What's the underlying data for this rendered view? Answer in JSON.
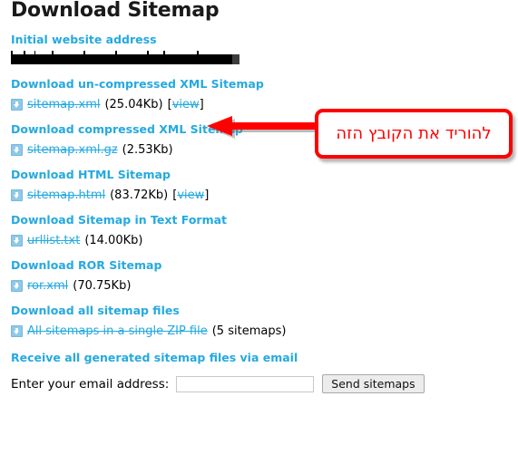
{
  "page": {
    "title": "Download Sitemap"
  },
  "initial": {
    "heading": "Initial website address",
    "url_redacted": true
  },
  "sections": [
    {
      "heading": "Download un-compressed XML Sitemap",
      "icon": "download-icon",
      "file_name": "sitemap.xml",
      "file_size": "(25.04Kb)",
      "view_open": "[",
      "view_label": "view",
      "view_close": "]"
    },
    {
      "heading": "Download compressed XML Sitemap",
      "icon": "download-icon",
      "file_name": "sitemap.xml.gz",
      "file_size": "(2.53Kb)"
    },
    {
      "heading": "Download HTML Sitemap",
      "icon": "download-icon",
      "file_name": "sitemap.html",
      "file_size": "(83.72Kb)",
      "view_open": "[",
      "view_label": "view",
      "view_close": "]"
    },
    {
      "heading": "Download Sitemap in Text Format",
      "icon": "download-icon",
      "file_name": "urllist.txt",
      "file_size": "(14.00Kb)"
    },
    {
      "heading": "Download ROR Sitemap",
      "icon": "download-icon",
      "file_name": "ror.xml",
      "file_size": "(70.75Kb)"
    },
    {
      "heading": "Download all sitemap files",
      "icon": "download-icon",
      "file_name": "All sitemaps in a single ZIP file",
      "file_size": "(5 sitemaps)"
    }
  ],
  "email": {
    "heading": "Receive all generated sitemap files via email",
    "label": "Enter your email address:",
    "value": "",
    "placeholder": "",
    "button_label": "Send sitemaps"
  },
  "annotation": {
    "text": "להוריד את הקובץ הזה",
    "color": "#FF0000",
    "arrow": "left-arrow-icon"
  },
  "colors": {
    "link_blue": "#25A9E0",
    "annotation_red": "#FF0000",
    "title_dark": "#1a1a1a"
  }
}
